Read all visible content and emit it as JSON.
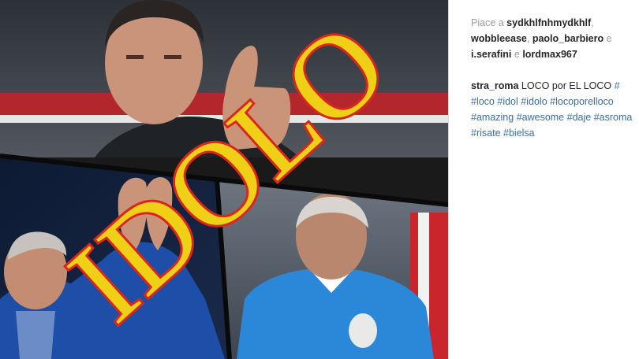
{
  "post": {
    "image": {
      "overlay_text": "IDOLO",
      "colors": {
        "overlay_text": "#f0d016",
        "overlay_outline": "#d8261c"
      }
    },
    "likes": {
      "prefix": "Piace a ",
      "users": [
        "sydkhlfnhmydkhlf",
        "wobbleease",
        "paolo_barbiero",
        "i.serafini",
        "lordmax967"
      ],
      "sep_comma": ", ",
      "sep_e": " e "
    },
    "caption": {
      "username": "stra_roma",
      "text": " LOCO por EL LOCO ",
      "hashtag_lines": [
        [
          "#"
        ],
        [
          "#loco",
          "#idol",
          "#idolo",
          "#locoporelloco"
        ],
        [
          "#amazing",
          "#awesome",
          "#daje",
          "#asroma"
        ],
        [
          "#risate",
          "#bielsa"
        ]
      ]
    }
  }
}
